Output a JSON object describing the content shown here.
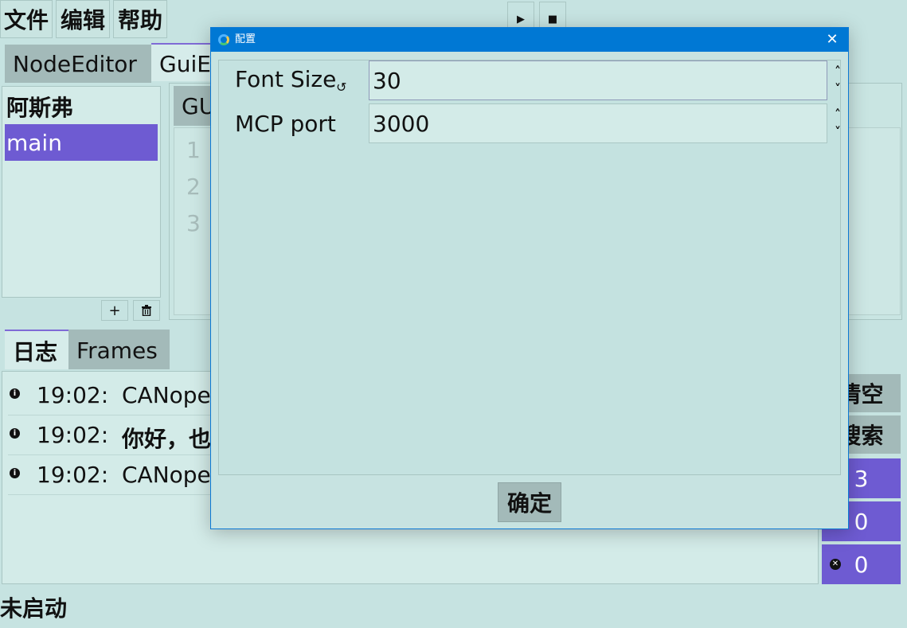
{
  "menu": {
    "file": "文件",
    "edit": "编辑",
    "help": "帮助"
  },
  "toolbar": {
    "play_icon": "play-icon",
    "stop_icon": "stop-icon"
  },
  "tabs": [
    {
      "label": "NodeEditor"
    },
    {
      "label": "GuiE"
    }
  ],
  "left_panel": {
    "title": "阿斯弗",
    "items": [
      {
        "label": "main",
        "selected": true
      }
    ],
    "add_label": "+",
    "delete_icon": "trash-icon"
  },
  "editor": {
    "tab_label": "GU",
    "line_numbers": [
      "1",
      "2",
      "3"
    ]
  },
  "log_tabs": [
    {
      "label": "日志"
    },
    {
      "label": "Frames"
    }
  ],
  "logs": [
    {
      "time": "19:02:",
      "message": "CANope"
    },
    {
      "time": "19:02:",
      "message": "你好，也"
    },
    {
      "time": "19:02:",
      "message": "CANope"
    }
  ],
  "side_buttons": {
    "clear": "清空",
    "search": "搜索"
  },
  "counts": {
    "info": "3",
    "warn": "0",
    "error": "0"
  },
  "status": "未启动",
  "dialog": {
    "title": "配置",
    "fields": [
      {
        "label": "Font Size",
        "value": "30"
      },
      {
        "label": "MCP port",
        "value": "3000"
      }
    ],
    "ok_label": "确定"
  },
  "colors": {
    "background": "#c6e3e1",
    "accent": "#6e5bd2",
    "titlebar": "#0078d4",
    "tab_inactive": "#a3bab9"
  }
}
